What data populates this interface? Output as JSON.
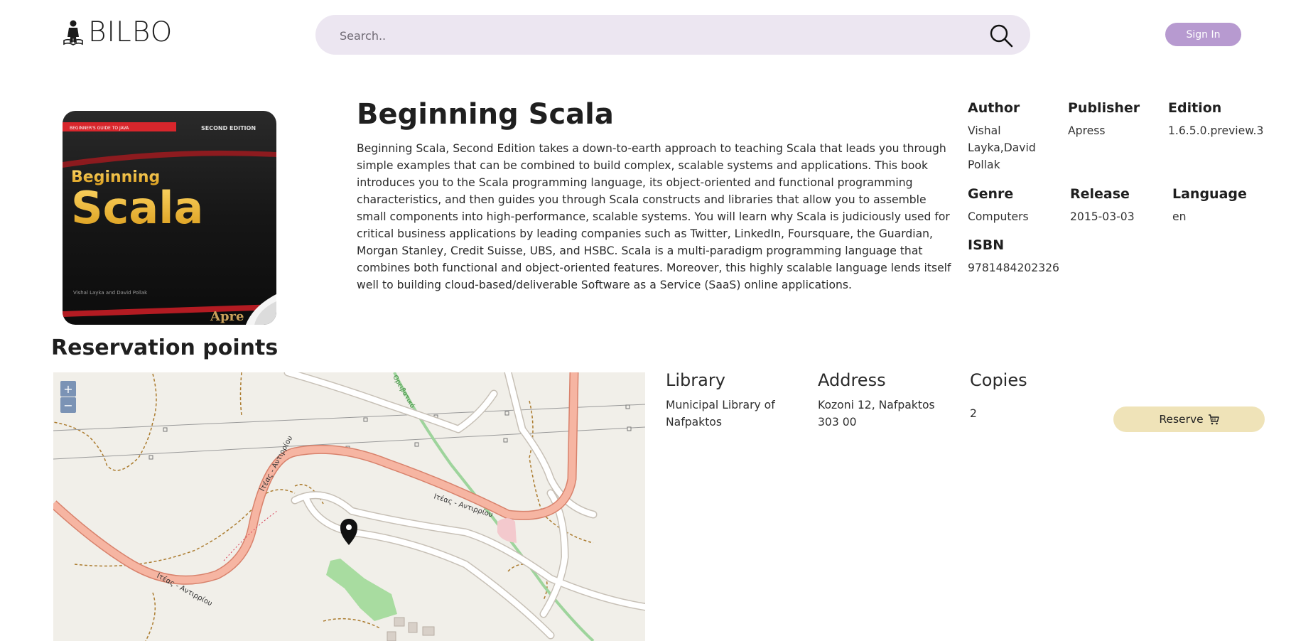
{
  "header": {
    "logo_text": "BILBO",
    "search_placeholder": "Search..",
    "signin_label": "Sign In"
  },
  "book": {
    "title": "Beginning Scala",
    "cover": {
      "series": "BEGINNER'S GUIDE TO JAVA",
      "edition": "SECOND EDITION",
      "line1": "Beginning",
      "line2": "Scala",
      "authors": "Vishal Layka and David Pollak",
      "publisher": "Apre"
    },
    "description": "Beginning Scala, Second Edition takes a down-to-earth approach to teaching Scala that leads you through simple examples that can be combined to build complex, scalable systems and applications. This book introduces you to the Scala programming language, its object-oriented and functional programming characteristics, and then guides you through Scala constructs and libraries that allow you to assemble small components into high-performance, scalable systems. You will learn why Scala is judiciously used for critical business applications by leading companies such as Twitter, LinkedIn, Foursquare, the Guardian, Morgan Stanley, Credit Suisse, UBS, and HSBC. Scala is a multi-paradigm programming language that combines both functional and object-oriented features. Moreover, this highly scalable language lends itself well to building cloud-based/deliverable Software as a Service (SaaS) online applications.",
    "meta": {
      "author_label": "Author",
      "author_value": "Vishal Layka,David Pollak",
      "publisher_label": "Publisher",
      "publisher_value": "Apress",
      "edition_label": "Edition",
      "edition_value": "1.6.5.0.preview.3",
      "genre_label": "Genre",
      "genre_value": "Computers",
      "release_label": "Release",
      "release_value": "2015-03-03",
      "language_label": "Language",
      "language_value": "en",
      "isbn_label": "ISBN",
      "isbn_value": "9781484202326"
    }
  },
  "reservation": {
    "title": "Reservation points",
    "map": {
      "zoom_in": "+",
      "zoom_out": "−",
      "road_label": "Ιτέας - Αντιρρίου",
      "path_label": "Ορειβατικό"
    },
    "columns": {
      "library": "Library",
      "address": "Address",
      "copies": "Copies"
    },
    "rows": [
      {
        "library": "Municipal Library of Nafpaktos",
        "address": "Kozoni 12, Nafpaktos 303 00",
        "copies": "2",
        "reserve_label": "Reserve"
      }
    ]
  },
  "colors": {
    "search_bg": "#ece6f1",
    "signin_bg": "#b79ad0",
    "reserve_bg": "#efe3b8",
    "road": "#f2a58f"
  }
}
